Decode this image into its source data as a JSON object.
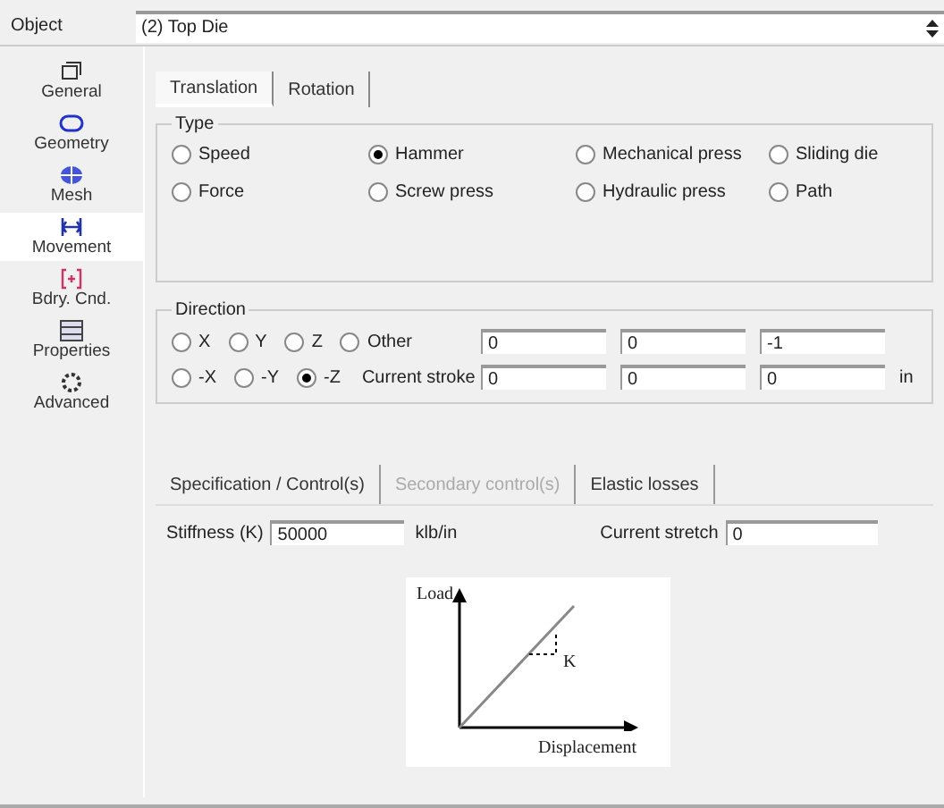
{
  "object": {
    "label": "Object",
    "value": "(2) Top Die"
  },
  "sidebar": [
    {
      "label": "General",
      "selected": false
    },
    {
      "label": "Geometry",
      "selected": false
    },
    {
      "label": "Mesh",
      "selected": false
    },
    {
      "label": "Movement",
      "selected": true
    },
    {
      "label": "Bdry. Cnd.",
      "selected": false
    },
    {
      "label": "Properties",
      "selected": false
    },
    {
      "label": "Advanced",
      "selected": false
    }
  ],
  "tabs": [
    {
      "label": "Translation",
      "selected": true
    },
    {
      "label": "Rotation",
      "selected": false
    }
  ],
  "type_group": {
    "title": "Type",
    "options": [
      {
        "label": "Speed",
        "selected": false
      },
      {
        "label": "Hammer",
        "selected": true
      },
      {
        "label": "Mechanical press",
        "selected": false
      },
      {
        "label": "Sliding die",
        "selected": false
      },
      {
        "label": "Force",
        "selected": false
      },
      {
        "label": "Screw press",
        "selected": false
      },
      {
        "label": "Hydraulic press",
        "selected": false
      },
      {
        "label": "Path",
        "selected": false
      }
    ]
  },
  "direction_group": {
    "title": "Direction",
    "row_1": [
      {
        "label": "X",
        "selected": false
      },
      {
        "label": "Y",
        "selected": false
      },
      {
        "label": "Z",
        "selected": false
      },
      {
        "label": "Other",
        "selected": false
      }
    ],
    "row_1_values": [
      "0",
      "0",
      "-1"
    ],
    "row_2": [
      {
        "label": "-X",
        "selected": false
      },
      {
        "label": "-Y",
        "selected": false
      },
      {
        "label": "-Z",
        "selected": true
      }
    ],
    "stroke_label": "Current stroke",
    "stroke_values": [
      "0",
      "0",
      "0"
    ],
    "stroke_unit": "in"
  },
  "sub_tabs": [
    {
      "label": "Specification / Control(s)",
      "disabled": false
    },
    {
      "label": "Secondary control(s)",
      "disabled": true
    },
    {
      "label": "Elastic losses",
      "disabled": false
    }
  ],
  "stiffness": {
    "label": "Stiffness (K)",
    "value": "50000",
    "unit": "klb/in"
  },
  "stretch": {
    "label": "Current stretch",
    "value": "0"
  },
  "diagram": {
    "y_label": "Load",
    "x_label": "Displacement",
    "k_label": "K"
  }
}
